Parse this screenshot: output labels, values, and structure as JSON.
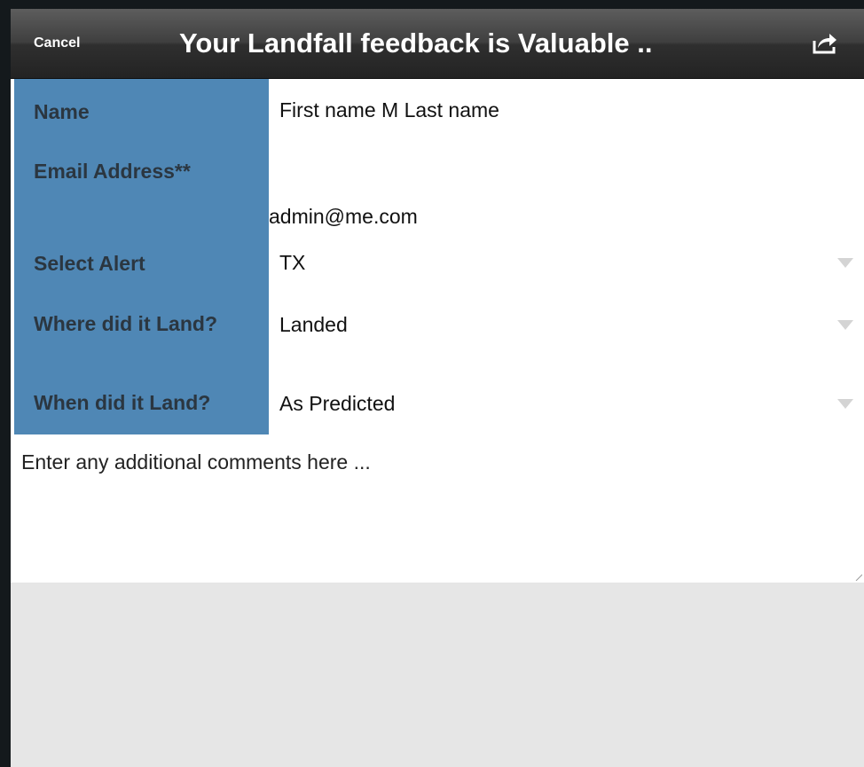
{
  "navbar": {
    "cancel_label": "Cancel",
    "title": "Your Landfall feedback is Valuable ..",
    "share_icon": "share-icon"
  },
  "form": {
    "name": {
      "label": "Name",
      "value": "First name M Last name"
    },
    "email": {
      "label": "Email Address**",
      "value": "admin@me.com"
    },
    "alert": {
      "label": "Select Alert",
      "value": "TX"
    },
    "where": {
      "label": "Where did it Land?",
      "value": "Landed"
    },
    "when": {
      "label": "When did it Land?",
      "value": "As Predicted"
    },
    "comments": {
      "placeholder": "Enter any additional comments here ..."
    }
  },
  "colors": {
    "label_column": "#4f87b5",
    "label_text": "#2b3640",
    "navbar_dark": "#232323",
    "background": "#e6e6e6"
  }
}
